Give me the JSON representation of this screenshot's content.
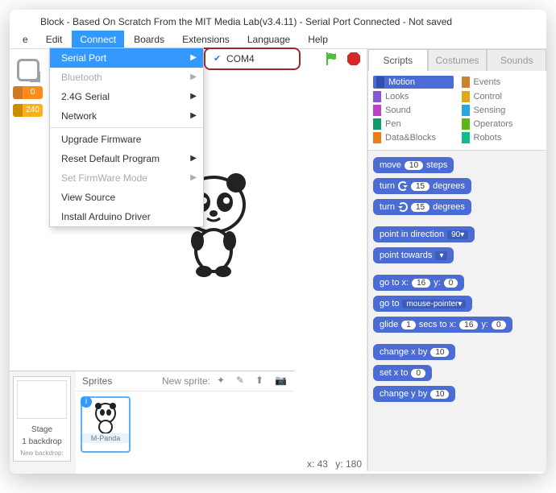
{
  "title": "Block - Based On Scratch From the MIT Media Lab(v3.4.11) - Serial Port Connected - Not saved",
  "menu": {
    "file": "e",
    "edit": "Edit",
    "connect": "Connect",
    "boards": "Boards",
    "extensions": "Extensions",
    "language": "Language",
    "help": "Help"
  },
  "connectMenu": {
    "serialPort": "Serial Port",
    "bluetooth": "Bluetooth",
    "g24": "2.4G Serial",
    "network": "Network",
    "upgrade": "Upgrade Firmware",
    "reset": "Reset Default Program",
    "setfw": "Set FirmWare Mode",
    "viewsrc": "View Source",
    "install": "Install Arduino Driver"
  },
  "submenu": {
    "com": "COM4"
  },
  "leftPills": {
    "p1": "0",
    "p2": "240"
  },
  "coords": {
    "x": "x: 43",
    "y": "y: 180"
  },
  "sprites": {
    "header": "Sprites",
    "newsprite": "New sprite:",
    "stage": "Stage",
    "backdropline": "1 backdrop",
    "newbackdrop": "New backdrop:",
    "sprite1": "M-Panda"
  },
  "tabs": {
    "scripts": "Scripts",
    "costumes": "Costumes",
    "sounds": "Sounds"
  },
  "cats": {
    "motion": "Motion",
    "events": "Events",
    "looks": "Looks",
    "control": "Control",
    "sound": "Sound",
    "sensing": "Sensing",
    "pen": "Pen",
    "operators": "Operators",
    "data": "Data&Blocks",
    "robots": "Robots"
  },
  "blocks": {
    "move_a": "move",
    "move_n": "10",
    "move_b": "steps",
    "turn_a": "turn",
    "turn_n": "15",
    "turn_b": "degrees",
    "pid_a": "point in direction",
    "pid_n": "90▾",
    "pt_a": "point towards",
    "pt_n": "▾",
    "goto_a": "go to x:",
    "goto_x": "16",
    "goto_b": "y:",
    "goto_y": "0",
    "gotom_a": "go to",
    "gotom_n": "mouse-pointer▾",
    "glide_a": "glide",
    "glide_s": "1",
    "glide_b": "secs to x:",
    "glide_x": "16",
    "glide_c": "y:",
    "glide_y": "0",
    "chx_a": "change x by",
    "chx_n": "10",
    "setx_a": "set x to",
    "setx_n": "0",
    "chy_a": "change y by",
    "chy_n": "10"
  }
}
